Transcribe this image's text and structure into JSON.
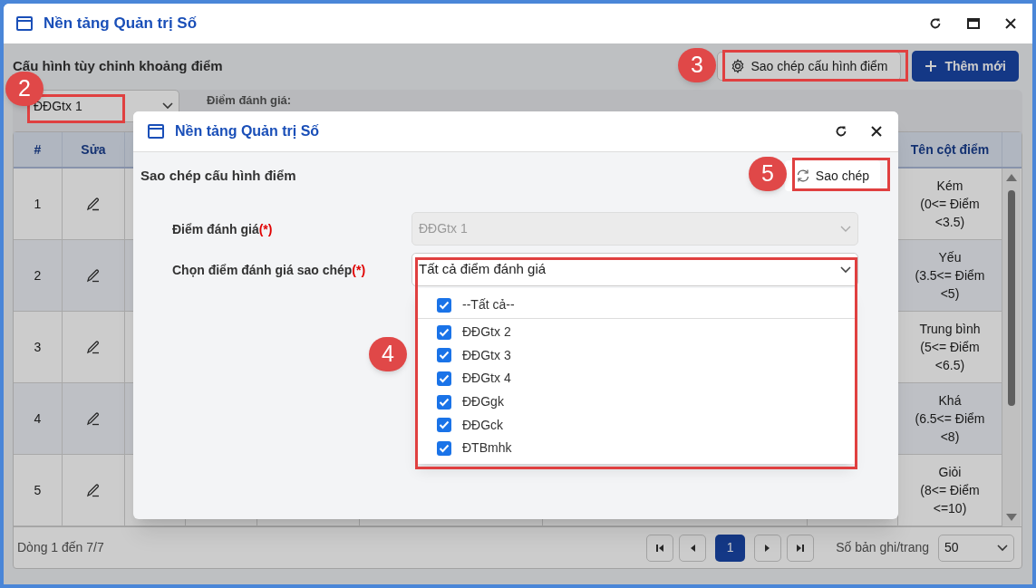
{
  "window": {
    "title": "Nền tảng Quản trị Số"
  },
  "page": {
    "heading": "Cấu hình tùy chỉnh khoảng điểm",
    "copy_config_button": "Sao chép cấu hình điểm",
    "add_button": "Thêm mới",
    "filter": {
      "value": "ĐĐGtx 1",
      "label": "Điểm đánh giá:"
    }
  },
  "table": {
    "columns": [
      {
        "label": "#"
      },
      {
        "label": "Sửa"
      },
      {
        "label": "Tên cột điểm"
      }
    ],
    "rows": [
      {
        "index": "1",
        "name": "Kém",
        "range": "(0<= Điểm <3.5)"
      },
      {
        "index": "2",
        "name": "Yếu",
        "range": "(3.5<= Điểm <5)"
      },
      {
        "index": "3",
        "name": "Trung bình",
        "range": "(5<= Điểm <6.5)"
      },
      {
        "index": "4",
        "name": "Khá",
        "range": "(6.5<= Điểm <8)"
      },
      {
        "index": "5",
        "name": "Giỏi",
        "range": "(8<= Điểm <=10)"
      }
    ]
  },
  "footer": {
    "summary": "Dòng 1 đến 7/7",
    "pages": [
      {
        "label": "1",
        "selected": true
      }
    ],
    "per_page_label": "Số bản ghi/trang",
    "per_page": "50"
  },
  "dialog": {
    "title": "Nền tảng Quản trị Số",
    "heading": "Sao chép cấu hình điểm",
    "copy_button": "Sao chép",
    "fields": [
      {
        "label": "Điểm đánh giá",
        "required_mark": "(*)",
        "value": "ĐĐGtx 1",
        "disabled": true
      },
      {
        "label": "Chọn điểm đánh giá sao chép",
        "required_mark": "(*)",
        "value": "Tất cả điểm đánh giá",
        "disabled": false
      }
    ],
    "options": [
      {
        "kind": "all",
        "label": "--Tất cả--",
        "checked": true
      },
      {
        "kind": "item",
        "label": "ĐĐGtx 2",
        "checked": true
      },
      {
        "kind": "item",
        "label": "ĐĐGtx 3",
        "checked": true
      },
      {
        "kind": "item",
        "label": "ĐĐGtx 4",
        "checked": true
      },
      {
        "kind": "item",
        "label": "ĐĐGgk",
        "checked": true
      },
      {
        "kind": "item",
        "label": "ĐĐGck",
        "checked": true
      },
      {
        "kind": "item",
        "label": "ĐTBmhk",
        "checked": true
      }
    ]
  },
  "callouts": [
    {
      "number": "2"
    },
    {
      "number": "3"
    },
    {
      "number": "4"
    },
    {
      "number": "5"
    }
  ]
}
